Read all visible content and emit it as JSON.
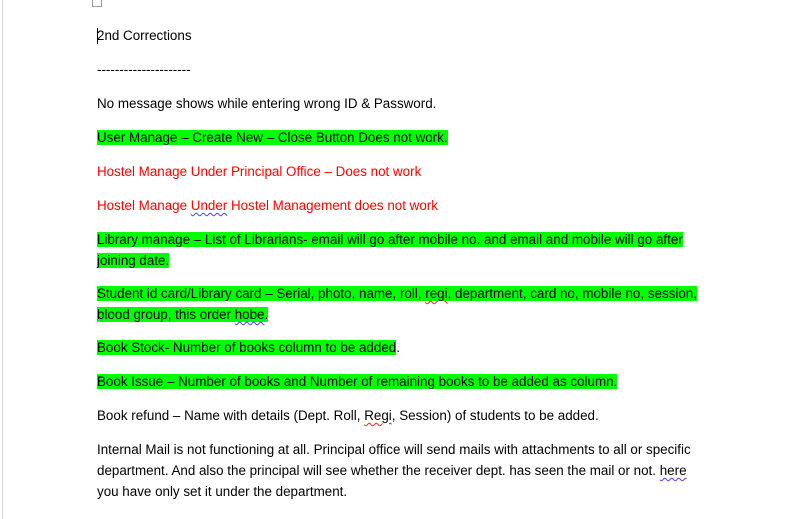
{
  "document": {
    "title": "2nd Corrections",
    "separator": "---------------------",
    "items": {
      "msg_login": "No message shows while entering wrong ID & Password.",
      "user_manage": "User Manage – Create New – Close Button Does not work.",
      "hostel_principal": "Hostel Manage Under Principal Office – Does not work",
      "hostel_mgmt_a": "Hostel Manage ",
      "hostel_mgmt_under": "Under",
      "hostel_mgmt_b": " Hostel Management does not work",
      "library_manage_1": "Library manage – List of Librarians- email will go after mobile no. and email and mobile will go after",
      "library_manage_2": "joining date.",
      "student_card_1a": "Student id card/Library card – Serial, photo, name, roll, ",
      "student_card_regi": "regi",
      "student_card_1b": ", department, card no, mobile no, session,",
      "student_card_2a": "blood group, this order ",
      "student_card_hobe": "hobe",
      "student_card_2b": ".",
      "book_stock": "Book Stock- Number of books column to be added",
      "book_stock_end": ".",
      "book_issue": "Book Issue – Number of books and Number of remaining books to be added as column.",
      "book_refund_a": "Book refund – Name with details (Dept. Roll, ",
      "book_refund_regi": "Regi",
      "book_refund_b": ", Session) of students to be added.",
      "internal_mail_1": "Internal Mail is not functioning at all. Principal office will send mails with attachments to all or specific",
      "internal_mail_2a": "department. And also the principal will see whether the receiver dept. has seen the mail or not. ",
      "internal_mail_here": "here",
      "internal_mail_3": "you have only set it under the department."
    }
  },
  "colors": {
    "highlight": "#00ff00",
    "red_text": "#ff0000",
    "grammar_squiggle": "#4040ff",
    "spelling_squiggle": "#ff2020"
  }
}
